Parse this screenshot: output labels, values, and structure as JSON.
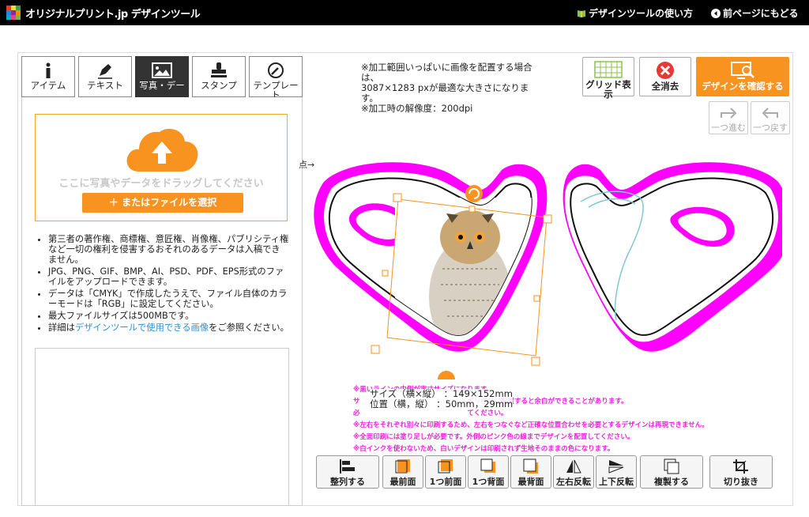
{
  "header": {
    "brand": "オリジナルプリント.jp デザインツール",
    "guide_link": "デザインツールの使い方",
    "back_link": "前ページにもどる"
  },
  "tabs": [
    {
      "label": "アイテム",
      "icon": "info-icon"
    },
    {
      "label": "テキスト",
      "icon": "pen-icon"
    },
    {
      "label": "写真・デー",
      "icon": "image-icon",
      "active": true
    },
    {
      "label": "スタンプ",
      "icon": "stamp-icon"
    },
    {
      "label": "テンプレー ト",
      "icon": "template-icon"
    }
  ],
  "upload": {
    "drop_text": "ここに写真やデータをドラッグしてください",
    "file_button": "＋ またはファイルを選択"
  },
  "notes": {
    "n1": "第三者の著作権、商標権、意匠権、肖像権、パブリシティ権など一切の権利を侵害するおそれのあるデータは入稿できません。",
    "n2": "JPG、PNG、GIF、BMP、AI、PSD、PDF、EPS形式のファイルをアップロードできます。",
    "n3": "データは「CMYK」で作成したうえで、ファイル自体のカラーモードは「RGB」に設定してください。",
    "n4": "最大ファイルサイズは500MBです。",
    "n5_pre": "詳細は",
    "n5_link": "デザインツールで使用できる画像",
    "n5_post": "をご参照ください。"
  },
  "info": {
    "line1": "※加工範囲いっぱいに画像を配置する場合は、",
    "line2": "3087×1283 pxが最適な大きさになります。",
    "line3": "※加工時の解像度：200dpi"
  },
  "right_buttons": {
    "grid": "グリッド表示",
    "clear": "全消去",
    "confirm": "デザインを確認する",
    "redo": "一つ進む",
    "undo": "一つ戻す"
  },
  "canvas": {
    "arrow_label": "点→"
  },
  "warnings": {
    "w1": "※黒いラインの内側が実寸サイズになります。",
    "w2": "サ　　　　　　　　　　　　　　　　ギリギリに配置すると余白ができることがあります。",
    "w3": "必　　　　　　　　　　　　　　　　てください。",
    "w4": "※左右をそれぞれ別々に印刷するため、左右をつなぐなど正確な位置合わせを必要とするデザインは再現できません。",
    "w5": "※全面印刷には塗り足しが必要です。外側のピンク色の線までデザインを配置してください。",
    "w6": "※白インクを使わないため、白いデザインは印刷されず生地そのままの色になります。"
  },
  "selection": {
    "size_label": "サイズ（横×縦）",
    "size_value": "：149×152mm",
    "pos_label": "位置（横，縦）",
    "pos_value": "：50mm，29mm"
  },
  "toolbar": [
    {
      "label": "整列する",
      "icon": "align-icon"
    },
    {
      "label": "最前面",
      "icon": "bring-front-icon"
    },
    {
      "label": "1つ前面",
      "icon": "bring-forward-icon"
    },
    {
      "label": "1つ背面",
      "icon": "send-backward-icon"
    },
    {
      "label": "最背面",
      "icon": "send-back-icon"
    },
    {
      "label": "左右反転",
      "icon": "flip-horizontal-icon"
    },
    {
      "label": "上下反転",
      "icon": "flip-vertical-icon"
    },
    {
      "label": "複製する",
      "icon": "duplicate-icon"
    },
    {
      "label": "切り抜き",
      "icon": "crop-icon"
    }
  ],
  "colors": {
    "accent": "#f7931e",
    "mask_outline": "#ff00ff",
    "warning_text": "#ee22dd",
    "link": "#2a8fd8"
  }
}
